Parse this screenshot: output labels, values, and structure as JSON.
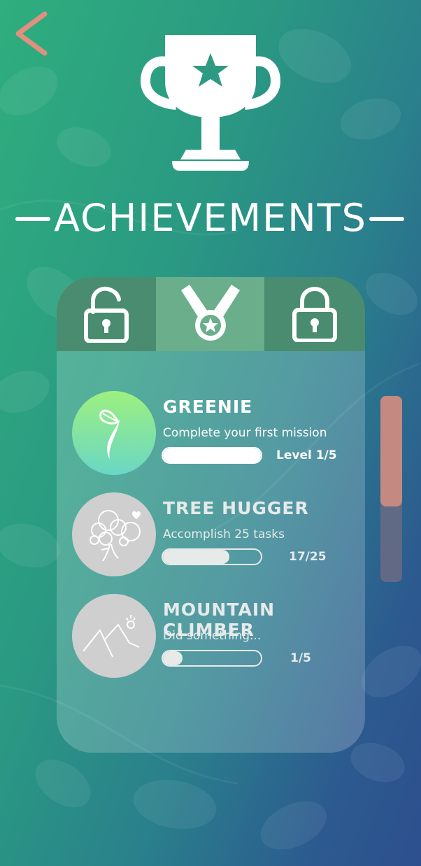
{
  "header": {
    "back_icon": "chevron-left-icon",
    "trophy_icon": "trophy-icon",
    "title": "ACHIEVEMENTS"
  },
  "colors": {
    "accent": "#e0907f",
    "tab_inactive": "#4a8c6f",
    "tab_active": "#6aae8b",
    "badge_green_top": "#9df07f",
    "badge_green_bottom": "#6ad7c5",
    "badge_locked": "#cfcfcf"
  },
  "tabs": [
    {
      "icon": "unlocked-padlock-icon",
      "active": false
    },
    {
      "icon": "medal-icon",
      "active": true
    },
    {
      "icon": "locked-padlock-icon",
      "active": false
    }
  ],
  "achievements": [
    {
      "name": "GREENIE",
      "description": "Complete your first mission",
      "level": "Level 1/5",
      "progress": 1.0,
      "icon": "sprout-icon",
      "unlocked": true
    },
    {
      "name": "TREE HUGGER",
      "description": "Accomplish 25 tasks",
      "level": "17/25",
      "progress": 0.68,
      "icon": "tree-icon",
      "unlocked": false
    },
    {
      "name": "MOUNTAIN CLIMBER",
      "description": "Did something...",
      "level": "1/5",
      "progress": 0.2,
      "icon": "mountain-icon",
      "unlocked": false
    }
  ],
  "scrollbar": {
    "position": 0.0
  }
}
